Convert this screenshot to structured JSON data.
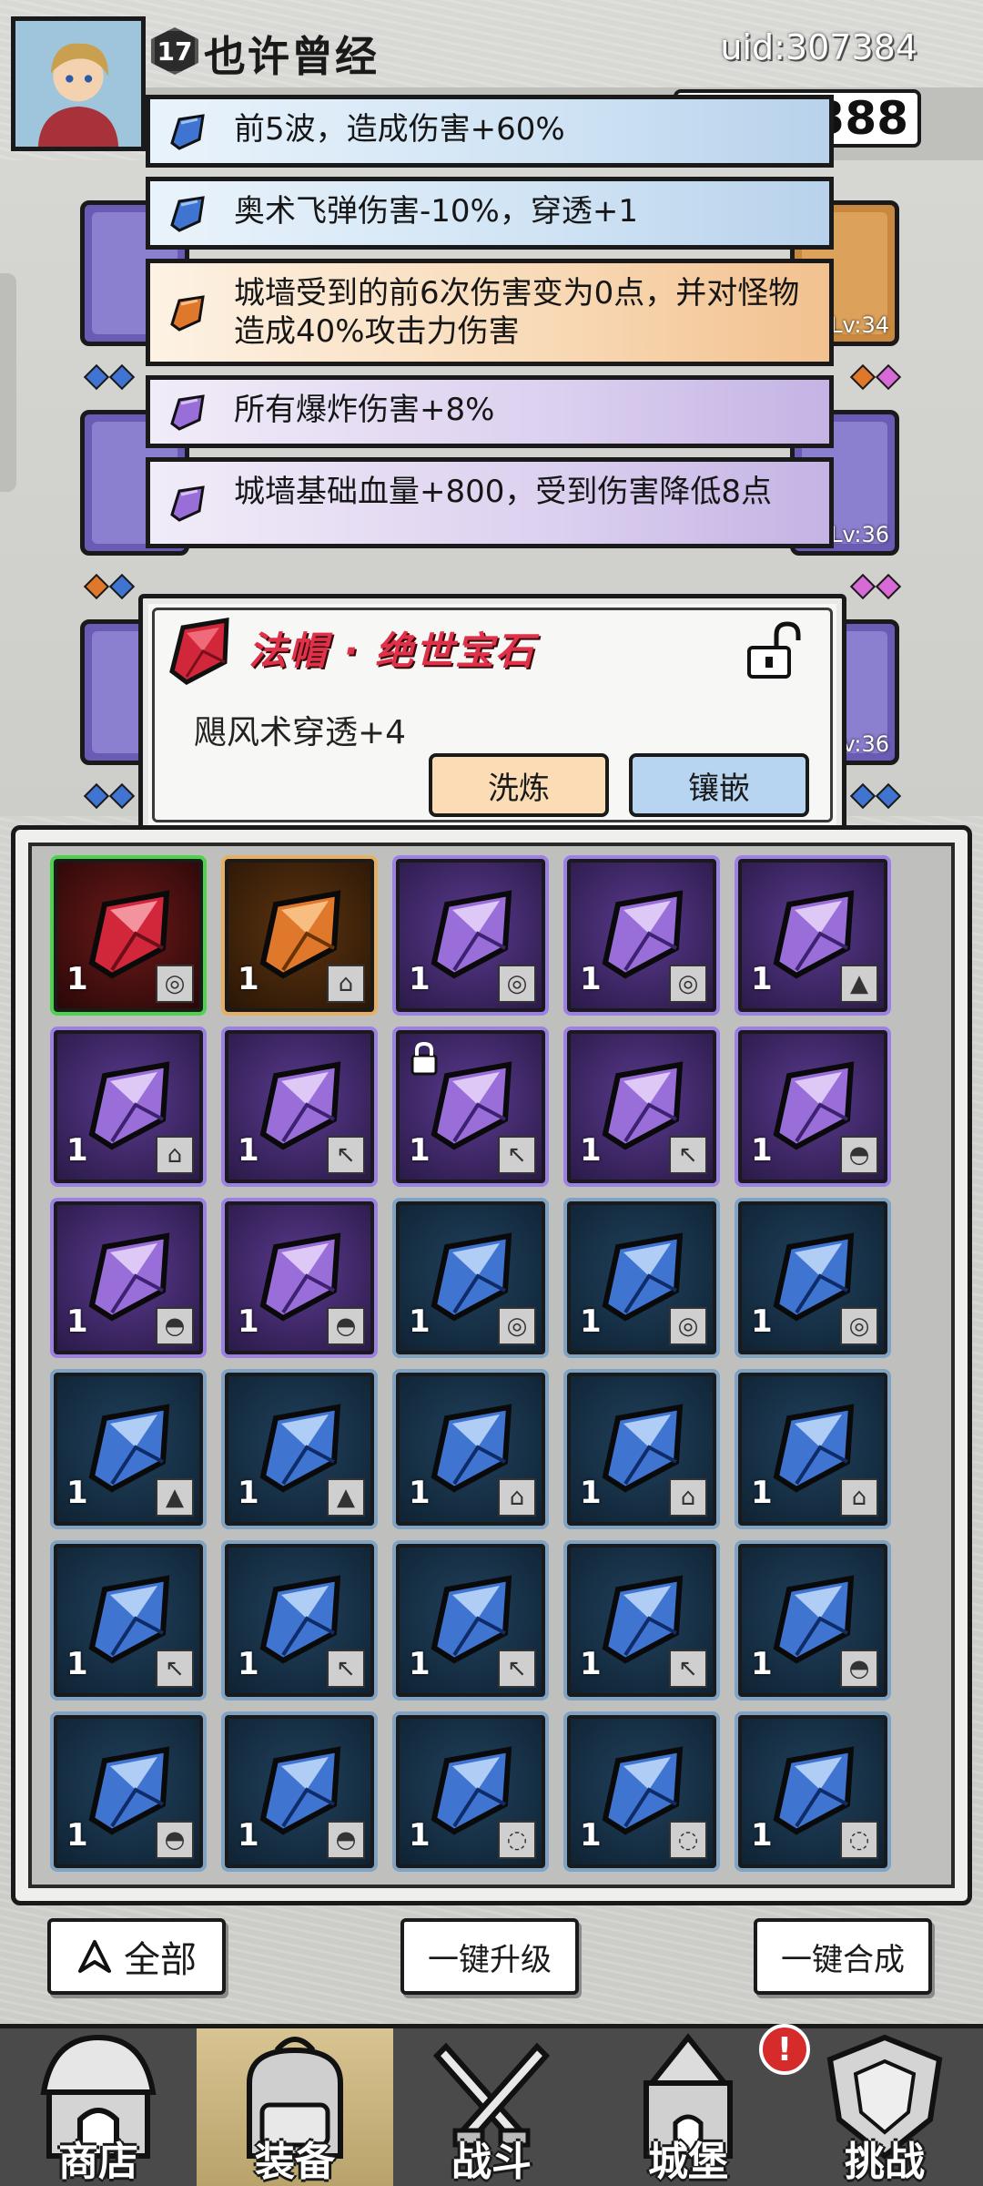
{
  "header": {
    "player_level": "17",
    "player_name": "也许曾经",
    "uid": "uid:307384",
    "currency_value": "388"
  },
  "equipment_levels": [
    "Lv:34",
    "Lv:36",
    "Lv:36"
  ],
  "affixes": [
    {
      "text": "前5波，造成伤害+60%",
      "color": "blue"
    },
    {
      "text": "奥术飞弹伤害-10%，穿透+1",
      "color": "blue"
    },
    {
      "text": "城墙受到的前6次伤害变为0点，并对怪物造成40%攻击力伤害",
      "color": "orange"
    },
    {
      "text": "所有爆炸伤害+8%",
      "color": "purple"
    },
    {
      "text": "城墙基础血量+800，受到伤害降低8点",
      "color": "purple"
    }
  ],
  "gem_popup": {
    "title": "法帽 · 绝世宝石",
    "description": "飓风术穿透+4",
    "refine_label": "洗炼",
    "inlay_label": "镶嵌",
    "lock_icon": "unlock-icon"
  },
  "inventory": {
    "rows": [
      [
        {
          "color": "red",
          "count": "1",
          "slot": "◎"
        },
        {
          "color": "orange",
          "count": "1",
          "slot": "⌂"
        },
        {
          "color": "purple",
          "count": "1",
          "slot": "◎"
        },
        {
          "color": "purple",
          "count": "1",
          "slot": "◎"
        },
        {
          "color": "purple",
          "count": "1",
          "slot": "▲"
        }
      ],
      [
        {
          "color": "purple",
          "count": "1",
          "slot": "⌂"
        },
        {
          "color": "purple",
          "count": "1",
          "slot": "↖"
        },
        {
          "color": "purple",
          "count": "1",
          "slot": "↖",
          "locked": true
        },
        {
          "color": "purple",
          "count": "1",
          "slot": "↖"
        },
        {
          "color": "purple",
          "count": "1",
          "slot": "◓"
        }
      ],
      [
        {
          "color": "purple",
          "count": "1",
          "slot": "◓"
        },
        {
          "color": "purple",
          "count": "1",
          "slot": "◓"
        },
        {
          "color": "blue",
          "count": "1",
          "slot": "◎"
        },
        {
          "color": "blue",
          "count": "1",
          "slot": "◎"
        },
        {
          "color": "blue",
          "count": "1",
          "slot": "◎"
        }
      ],
      [
        {
          "color": "blue",
          "count": "1",
          "slot": "▲"
        },
        {
          "color": "blue",
          "count": "1",
          "slot": "▲"
        },
        {
          "color": "blue",
          "count": "1",
          "slot": "⌂"
        },
        {
          "color": "blue",
          "count": "1",
          "slot": "⌂"
        },
        {
          "color": "blue",
          "count": "1",
          "slot": "⌂"
        }
      ],
      [
        {
          "color": "blue",
          "count": "1",
          "slot": "↖"
        },
        {
          "color": "blue",
          "count": "1",
          "slot": "↖"
        },
        {
          "color": "blue",
          "count": "1",
          "slot": "↖"
        },
        {
          "color": "blue",
          "count": "1",
          "slot": "↖"
        },
        {
          "color": "blue",
          "count": "1",
          "slot": "◓"
        }
      ],
      [
        {
          "color": "blue",
          "count": "1",
          "slot": "◓"
        },
        {
          "color": "blue",
          "count": "1",
          "slot": "◓"
        },
        {
          "color": "blue",
          "count": "1",
          "slot": "◌"
        },
        {
          "color": "blue",
          "count": "1",
          "slot": "◌"
        },
        {
          "color": "blue",
          "count": "1",
          "slot": "◌"
        }
      ]
    ]
  },
  "actions": {
    "all_label": "全部",
    "upgrade_label": "一键升级",
    "merge_label": "一键合成"
  },
  "nav": [
    {
      "label": "商店",
      "icon": "shop-icon"
    },
    {
      "label": "装备",
      "icon": "backpack-icon",
      "active": true
    },
    {
      "label": "战斗",
      "icon": "crossed-swords-icon"
    },
    {
      "label": "城堡",
      "icon": "castle-icon"
    },
    {
      "label": "挑战",
      "icon": "shield-challenge-icon"
    }
  ],
  "alert_badge": "!",
  "colors": {
    "red_gem": "#d2263a",
    "orange_gem": "#e0782c",
    "purple_gem": "#9a6ed8",
    "blue_gem": "#3f74d0",
    "popup_title": "#e0314b"
  }
}
